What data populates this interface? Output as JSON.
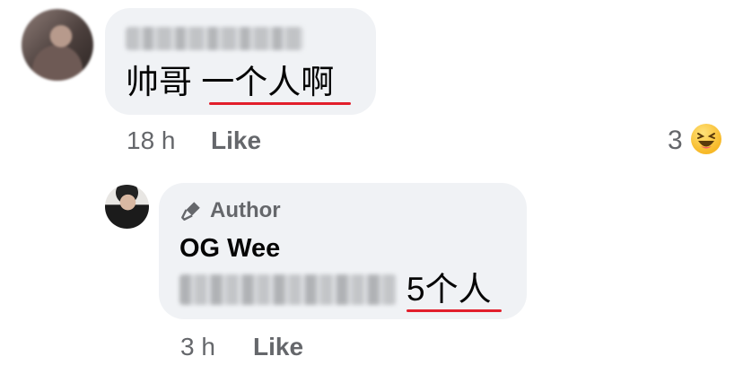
{
  "comment": {
    "text_plain": "帅哥 ",
    "text_underlined": "一个人啊",
    "time": "18 h",
    "like_label": "Like",
    "reaction_count": "3",
    "reaction_icon": "haha-emoji-icon",
    "reaction_color": "#f7b928"
  },
  "reply": {
    "badge_icon": "microphone-icon",
    "badge_label": "Author",
    "author_name": "OG Wee",
    "text_underlined": "5个人",
    "time": "3 h",
    "like_label": "Like"
  },
  "colors": {
    "bubble": "#f0f2f5",
    "secondary_text": "#65676b",
    "underline": "#e21f2c"
  }
}
